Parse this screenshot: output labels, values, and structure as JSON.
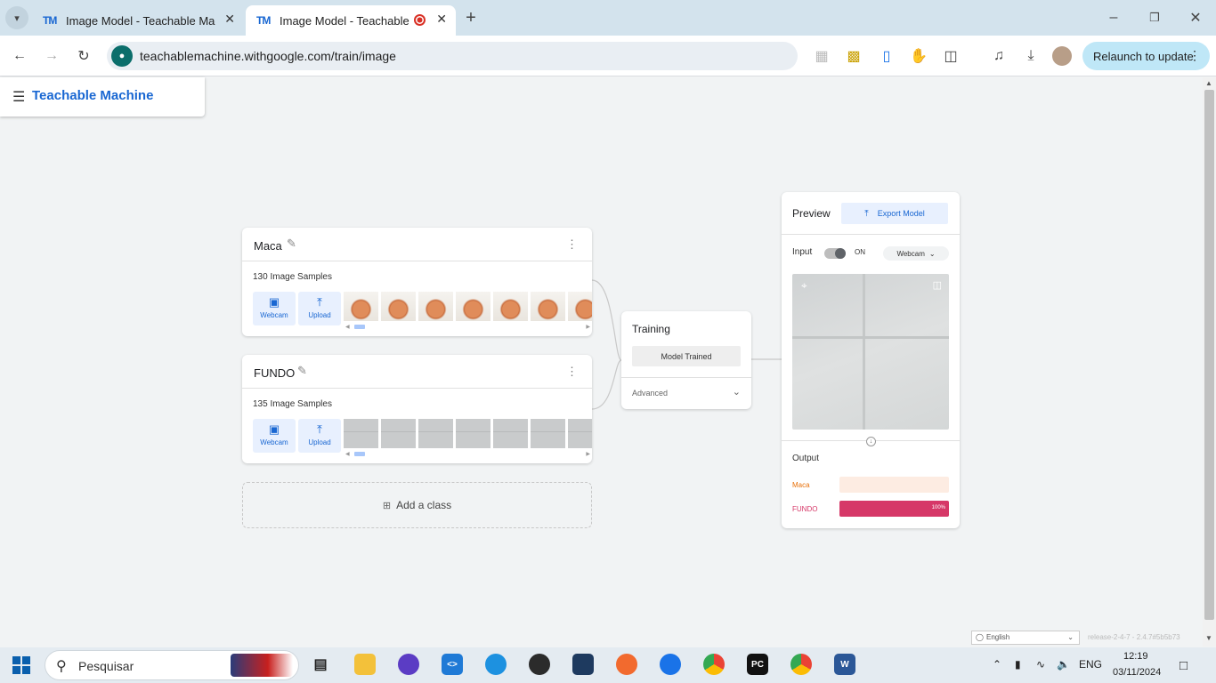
{
  "browser": {
    "tabs": [
      {
        "favicon": "TM",
        "title": "Image Model - Teachable Machine"
      },
      {
        "favicon": "TM",
        "title": "Image Model - Teachable Machine"
      }
    ],
    "url": "teachablemachine.withgoogle.com/train/image",
    "relaunch_label": "Relaunch to update"
  },
  "app": {
    "title": "Teachable Machine"
  },
  "classes": [
    {
      "name": "Maca",
      "samples": "130 Image Samples",
      "webcam_label": "Webcam",
      "upload_label": "Upload",
      "thumb_kind": "apple"
    },
    {
      "name": "FUNDO",
      "samples": "135 Image Samples",
      "webcam_label": "Webcam",
      "upload_label": "Upload",
      "thumb_kind": "wall"
    }
  ],
  "add_class_label": "Add a class",
  "training": {
    "title": "Training",
    "button_label": "Model Trained",
    "advanced_label": "Advanced"
  },
  "preview": {
    "title": "Preview",
    "export_label": "Export Model",
    "input_label": "Input",
    "toggle_state": "ON",
    "source_select": "Webcam",
    "output_label": "Output",
    "outputs": [
      {
        "label": "Maca",
        "percent": 0,
        "percent_text": "",
        "color": "#e8710a",
        "track": "#fdece2"
      },
      {
        "label": "FUNDO",
        "percent": 100,
        "percent_text": "100%",
        "color": "#d63868",
        "track": "#fbe3ea"
      }
    ]
  },
  "footer": {
    "language": "English",
    "release": "release-2-4-7 - 2.4.7#5b5b73"
  },
  "taskbar": {
    "search_placeholder": "Pesquisar",
    "lang": "ENG",
    "time": "12:19",
    "date": "03/11/2024"
  }
}
